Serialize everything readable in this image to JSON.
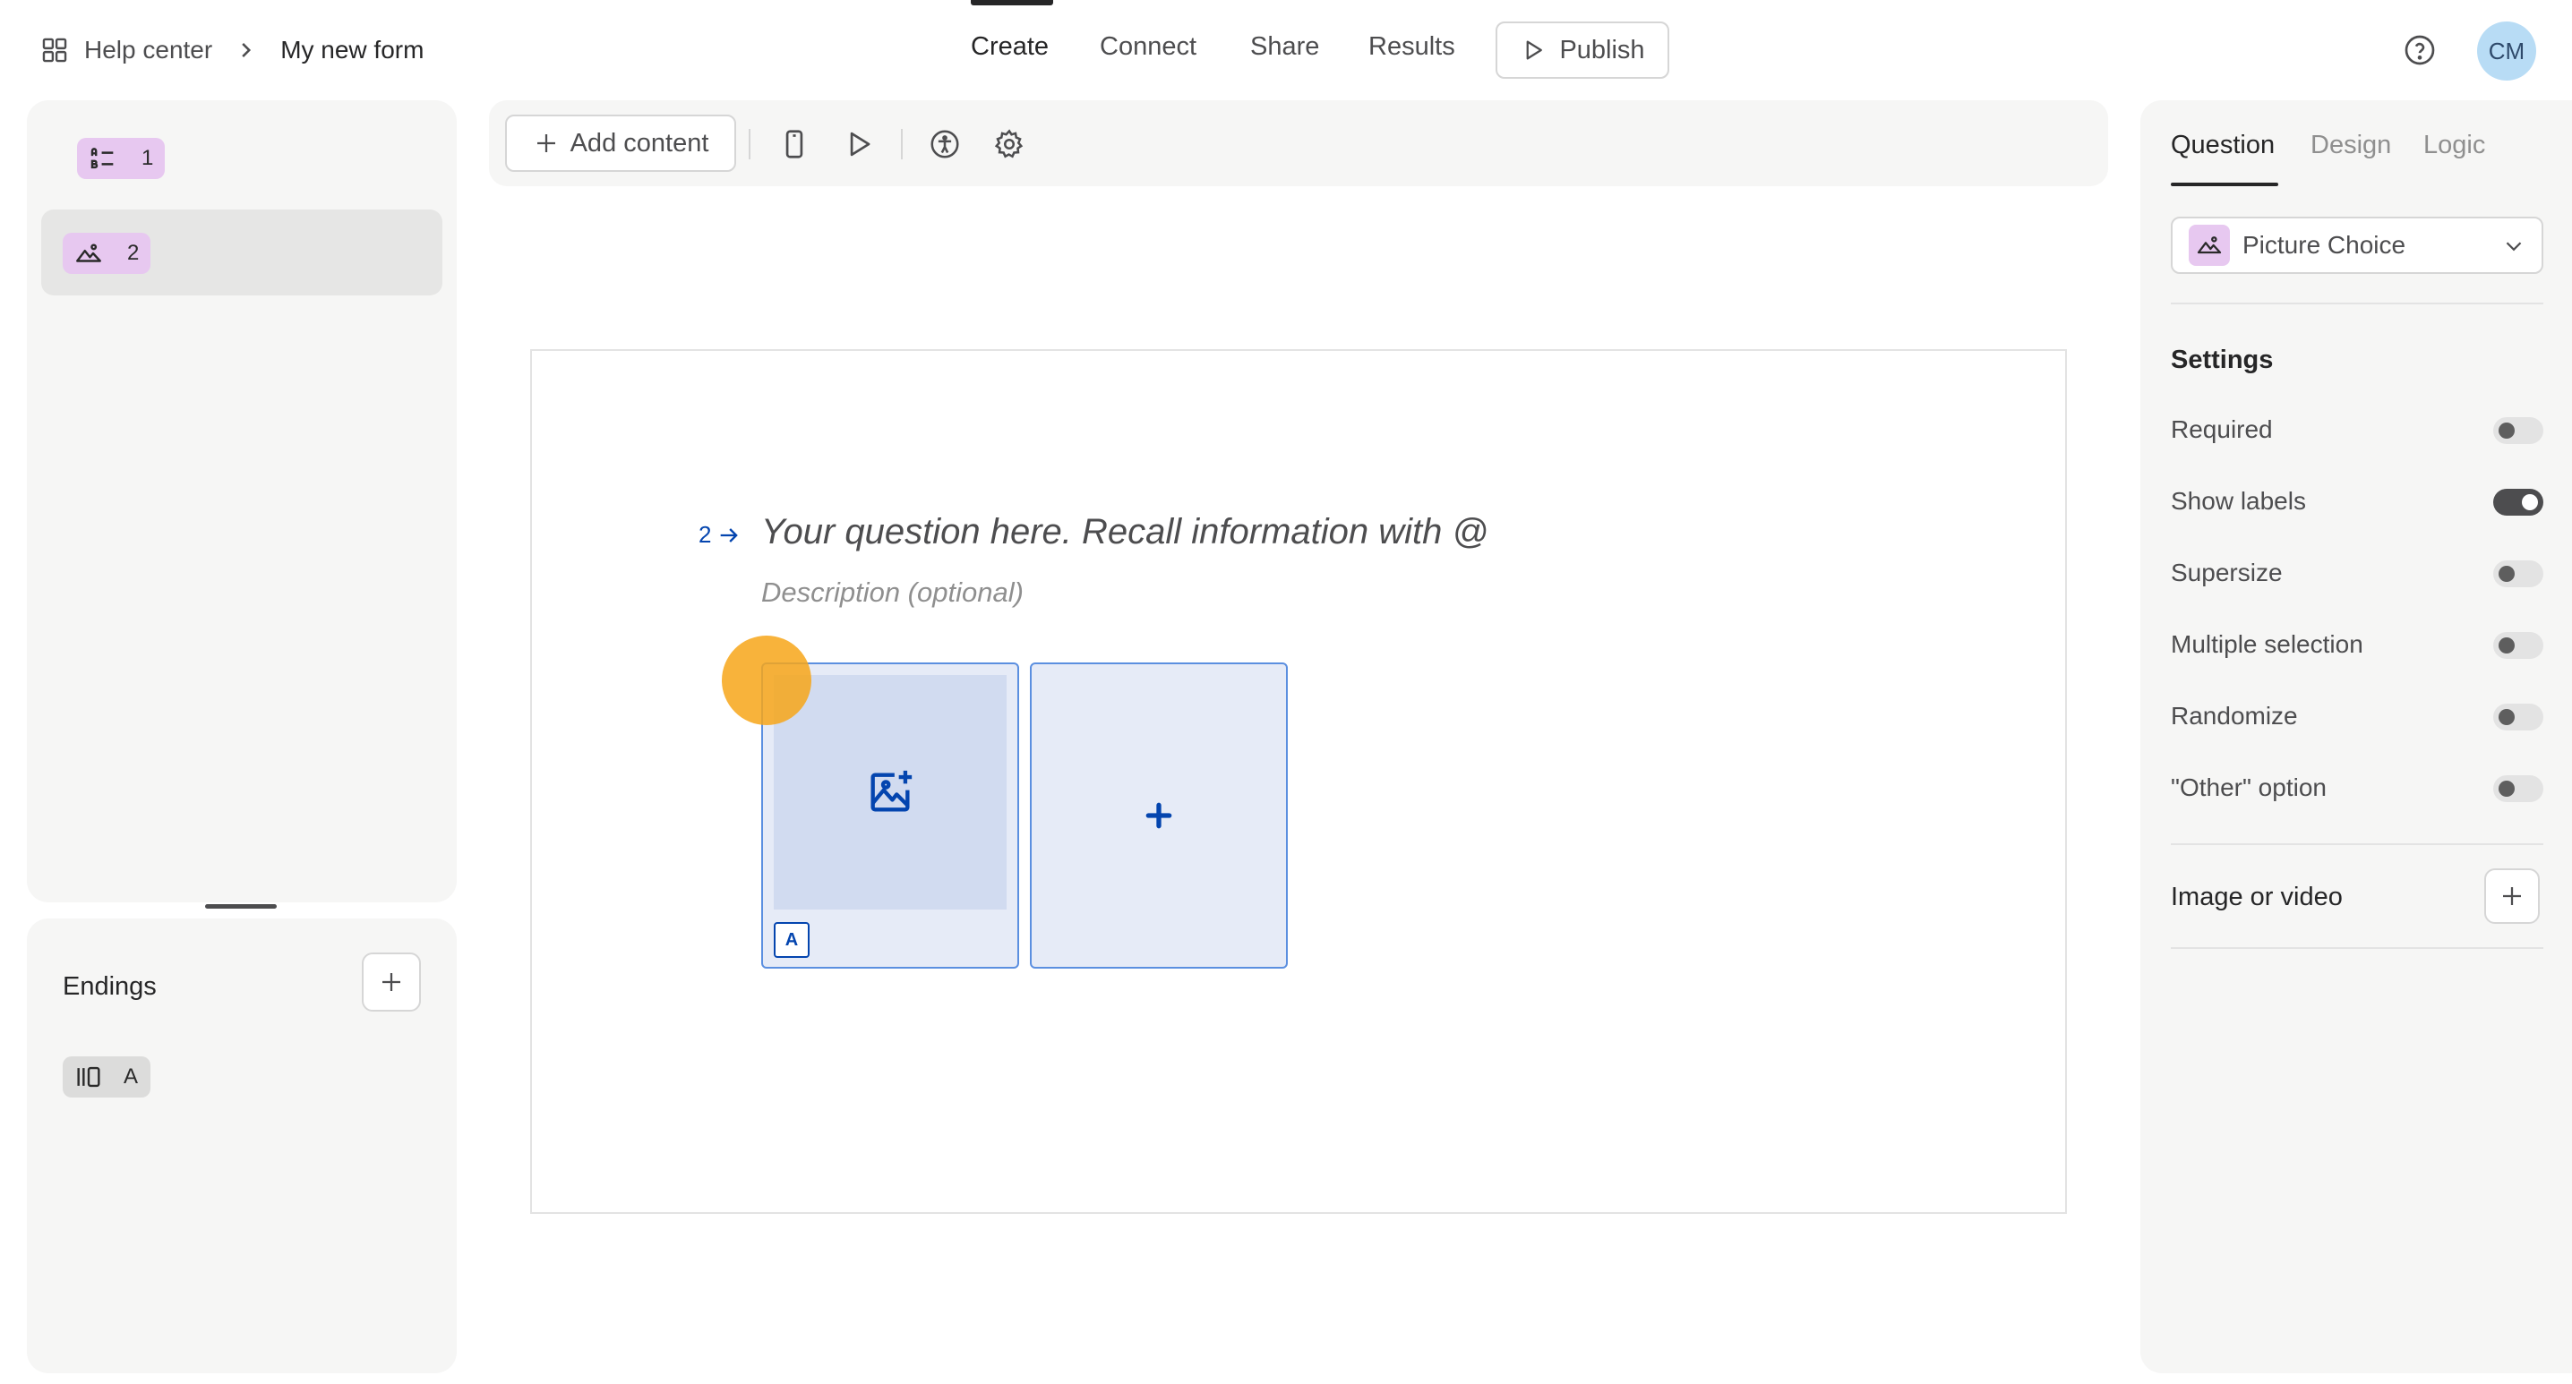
{
  "breadcrumb": {
    "workspace": "Help center",
    "form_name": "My new form"
  },
  "nav": {
    "tabs": [
      {
        "label": "Create",
        "active": true
      },
      {
        "label": "Connect",
        "active": false
      },
      {
        "label": "Share",
        "active": false
      },
      {
        "label": "Results",
        "active": false
      }
    ],
    "publish_label": "Publish"
  },
  "user": {
    "initials": "CM"
  },
  "sidebar": {
    "questions": [
      {
        "number": "1",
        "icon": "list-choice-icon"
      },
      {
        "number": "2",
        "icon": "picture-choice-icon",
        "selected": true
      }
    ],
    "endings": {
      "title": "Endings",
      "items": [
        {
          "letter": "A",
          "icon": "ending-screen-icon"
        }
      ]
    }
  },
  "toolbar": {
    "add_content_label": "Add content"
  },
  "question": {
    "number": "2",
    "text": "Your question here. Recall information with @",
    "description_placeholder": "Description (optional)",
    "choices": [
      {
        "key": "A",
        "has_image": false
      }
    ]
  },
  "right_panel": {
    "tabs": [
      {
        "label": "Question",
        "active": true
      },
      {
        "label": "Design",
        "active": false
      },
      {
        "label": "Logic",
        "active": false
      }
    ],
    "question_type": "Picture Choice",
    "settings_title": "Settings",
    "settings": [
      {
        "label": "Required",
        "on": false
      },
      {
        "label": "Show labels",
        "on": true
      },
      {
        "label": "Supersize",
        "on": false
      },
      {
        "label": "Multiple selection",
        "on": false
      },
      {
        "label": "Randomize",
        "on": false
      },
      {
        "label": "\"Other\" option",
        "on": false
      }
    ],
    "image_or_video_label": "Image or video"
  },
  "colors": {
    "accent_blue": "#0445af",
    "badge_purple": "#e7c8f0",
    "cursor_orange": "#f7a619",
    "avatar_blue": "#b8dcf5"
  }
}
